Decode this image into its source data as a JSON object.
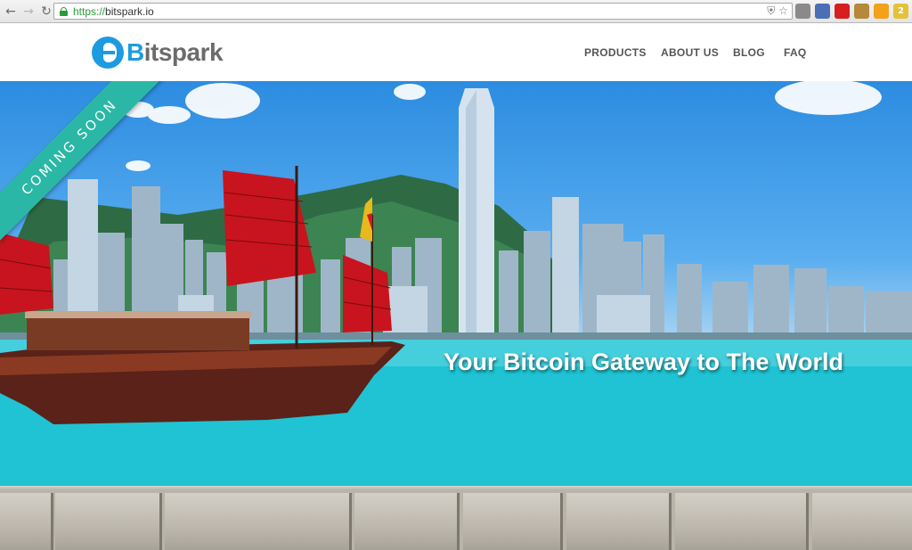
{
  "browser": {
    "url_scheme": "https://",
    "url_host": "bitspark.io",
    "back_icon": "arrow-left-icon",
    "forward_icon": "arrow-right-icon",
    "reload_icon": "reload-icon",
    "extensions": [
      {
        "name": "shield-extension-icon",
        "color": "#8a8a8a",
        "glyph": ""
      },
      {
        "name": "calendar-extension-icon",
        "color": "#4a6fb5",
        "glyph": ""
      },
      {
        "name": "opera-extension-icon",
        "color": "#d62020",
        "glyph": ""
      },
      {
        "name": "robot-extension-icon",
        "color": "#b5883a",
        "glyph": ""
      },
      {
        "name": "bitcoin-extension-icon",
        "color": "#f2a11a",
        "glyph": ""
      },
      {
        "name": "mail-extension-icon",
        "color": "#e3c23a",
        "glyph": "2"
      },
      {
        "name": "menu-icon",
        "color": "#4a9b3a",
        "glyph": "≡"
      }
    ]
  },
  "site": {
    "logo_b": "B",
    "logo_rest": "itspark",
    "nav": [
      "PRODUCTS",
      "ABOUT US",
      "BLOG",
      "FAQ"
    ]
  },
  "hero": {
    "ribbon": "COMING SOON",
    "slogan": "Your Bitcoin Gateway to The World",
    "accent": "#2bb7a5"
  }
}
